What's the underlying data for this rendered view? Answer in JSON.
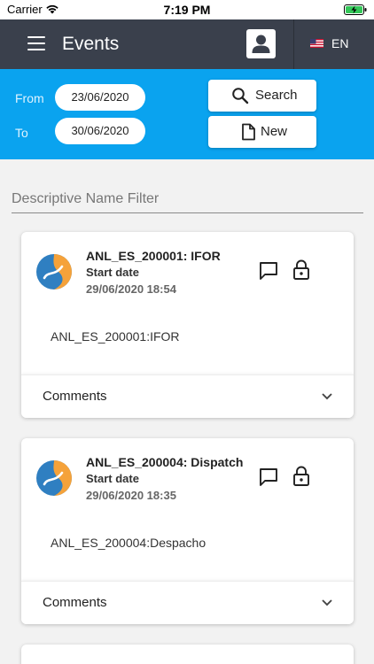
{
  "status_bar": {
    "carrier": "Carrier",
    "time": "7:19 PM"
  },
  "app_bar": {
    "title": "Events",
    "language": "EN"
  },
  "filter": {
    "from_label": "From",
    "from_date": "23/06/2020",
    "to_label": "To",
    "to_date": "30/06/2020",
    "search_label": "Search",
    "new_label": "New"
  },
  "name_filter": {
    "placeholder": "Descriptive Name Filter",
    "value": ""
  },
  "events": [
    {
      "title": "ANL_ES_200001: IFOR",
      "start_label": "Start date",
      "start_date": "29/06/2020 18:54",
      "description": "ANL_ES_200001:IFOR",
      "comments_label": "Comments"
    },
    {
      "title": "ANL_ES_200004: Dispatch",
      "start_label": "Start date",
      "start_date": "29/06/2020 18:35",
      "description": "ANL_ES_200004:Despacho",
      "comments_label": "Comments"
    }
  ],
  "colors": {
    "app_bar": "#3a404c",
    "filter_bar": "#0aa3ef",
    "background": "#f2f2f2",
    "logo_blue": "#2f7fc1",
    "logo_orange": "#f5a23a"
  }
}
